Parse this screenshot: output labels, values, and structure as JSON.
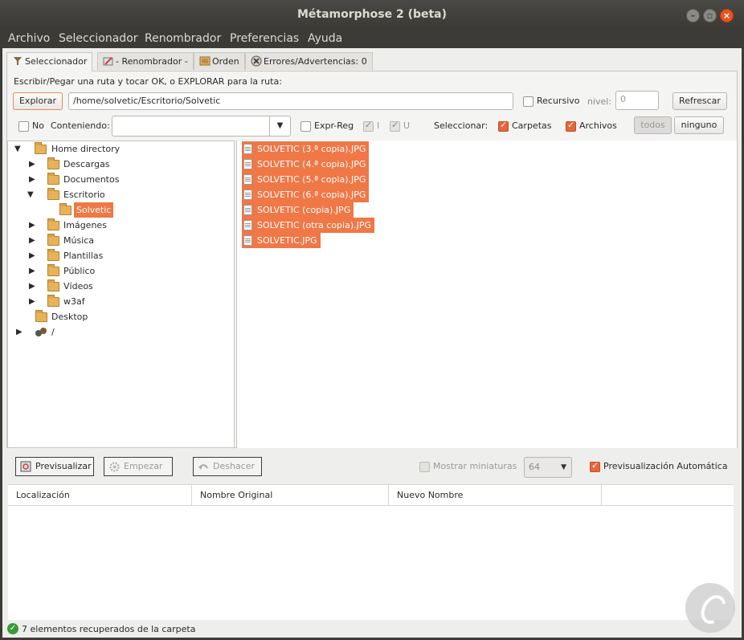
{
  "window": {
    "title": "Métamorphose 2 (beta)"
  },
  "menubar": [
    "Archivo",
    "Seleccionador",
    "Renombrador",
    "Preferencias",
    "Ayuda"
  ],
  "tabs": [
    {
      "label": "Seleccionador",
      "icon": "picker-icon",
      "active": true
    },
    {
      "label": "- Renombrador -",
      "icon": "rename-icon",
      "active": false
    },
    {
      "label": "Orden",
      "icon": "order-icon",
      "active": false
    },
    {
      "label": "Errores/Advertencias: 0",
      "icon": "error-icon",
      "active": false
    }
  ],
  "selector": {
    "instructions": "Escribir/Pegar una ruta y tocar OK, o EXPLORAR para la ruta:",
    "explore_label": "Explorar",
    "path_value": "/home/solvetic/Escritorio/Solvetic",
    "recursive_label": "Recursivo",
    "level_label": "nivel:",
    "level_value": "0",
    "refresh_label": "Refrescar",
    "no_label": "No",
    "containing_label": "Conteniendo:",
    "containing_value": "",
    "regex_label": "Expr-Reg",
    "i_label": "I",
    "u_label": "U",
    "select_label": "Seleccionar:",
    "folders_label": "Carpetas",
    "files_label": "Archivos",
    "all_label": "todos",
    "none_label": "ninguno"
  },
  "tree": [
    {
      "label": "Home directory",
      "expanded": true,
      "level": 0
    },
    {
      "label": "Descargas",
      "expanded": false,
      "level": 1
    },
    {
      "label": "Documentos",
      "expanded": false,
      "level": 1
    },
    {
      "label": "Escritorio",
      "expanded": true,
      "level": 1
    },
    {
      "label": "Solvetic",
      "level": 2,
      "selected": true
    },
    {
      "label": "Imágenes",
      "expanded": false,
      "level": 1
    },
    {
      "label": "Música",
      "expanded": false,
      "level": 1
    },
    {
      "label": "Plantillas",
      "expanded": false,
      "level": 1
    },
    {
      "label": "Público",
      "expanded": false,
      "level": 1
    },
    {
      "label": "Vídeos",
      "expanded": false,
      "level": 1
    },
    {
      "label": "w3af",
      "expanded": false,
      "level": 1
    },
    {
      "label": "Desktop",
      "level": 0
    },
    {
      "label": "/",
      "expanded": false,
      "level": 0
    }
  ],
  "files": [
    "SOLVETIC (3.ª copia).JPG",
    "SOLVETIC (4.ª copia).JPG",
    "SOLVETIC (5.ª copia).JPG",
    "SOLVETIC (6.ª copia).JPG",
    "SOLVETIC (copia).JPG",
    "SOLVETIC (otra copia).JPG",
    "SOLVETIC.JPG"
  ],
  "bottom": {
    "preview_label": "Previsualizar",
    "start_label": "Empezar",
    "undo_label": "Deshacer",
    "thumbs_label": "Mostrar miniaturas",
    "thumb_size": "64",
    "autopreview_label": "Previsualización Automática"
  },
  "grid_columns": [
    "Localización",
    "Nombre Original",
    "Nuevo Nombre"
  ],
  "status": {
    "text": "7 elementos recuperados de la carpeta"
  },
  "colors": {
    "accent": "#f07746",
    "titlebar": "#3c3b37",
    "close": "#e95420"
  }
}
